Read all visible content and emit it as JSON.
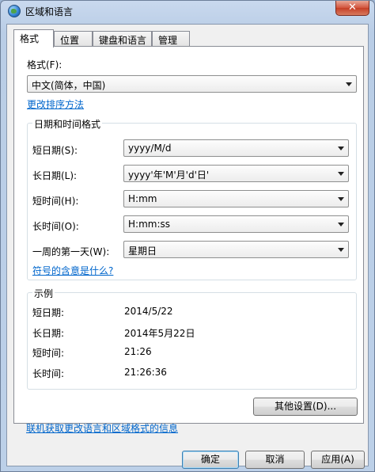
{
  "window": {
    "title": "区域和语言",
    "close_glyph": "✕"
  },
  "tabs": [
    {
      "label": "格式",
      "active": true
    },
    {
      "label": "位置",
      "active": false
    },
    {
      "label": "键盘和语言",
      "active": false
    },
    {
      "label": "管理",
      "active": false
    }
  ],
  "format": {
    "label": "格式(F):",
    "value": "中文(简体，中国)",
    "change_sort_link": "更改排序方法"
  },
  "datetime_group": {
    "title": "日期和时间格式",
    "rows": [
      {
        "label": "短日期(S):",
        "value": "yyyy/M/d"
      },
      {
        "label": "长日期(L):",
        "value": "yyyy'年'M'月'd'日'"
      },
      {
        "label": "短时间(H):",
        "value": "H:mm"
      },
      {
        "label": "长时间(O):",
        "value": "H:mm:ss"
      },
      {
        "label": "一周的第一天(W):",
        "value": "星期日"
      }
    ],
    "symbol_link": "符号的含意是什么?"
  },
  "example_group": {
    "title": "示例",
    "rows": [
      {
        "label": "短日期:",
        "value": "2014/5/22"
      },
      {
        "label": "长日期:",
        "value": "2014年5月22日"
      },
      {
        "label": "短时间:",
        "value": "21:26"
      },
      {
        "label": "长时间:",
        "value": "21:26:36"
      }
    ]
  },
  "other_settings_button": "其他设置(D)...",
  "online_link": "联机获取更改语言和区域格式的信息",
  "footer": {
    "ok": "确定",
    "cancel": "取消",
    "apply": "应用(A)"
  }
}
